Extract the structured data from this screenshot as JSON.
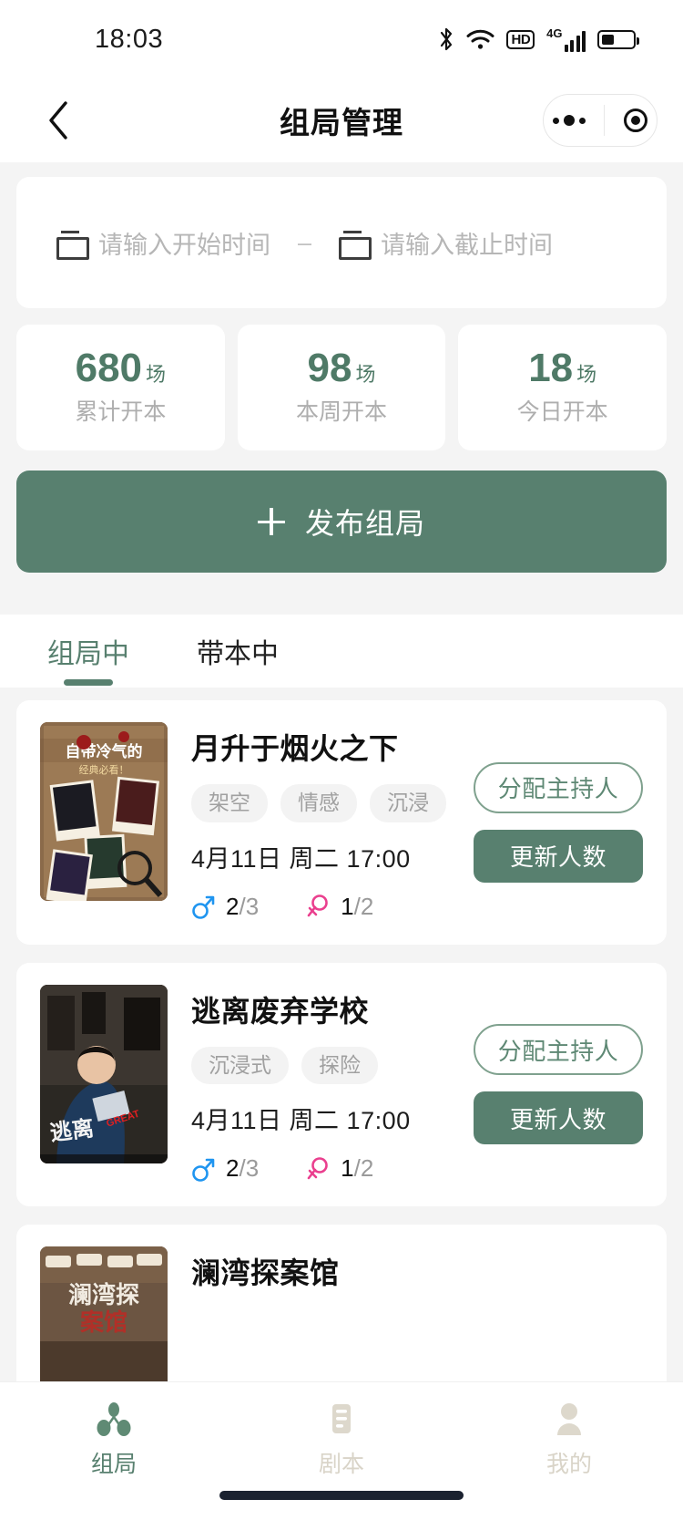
{
  "status_bar": {
    "time": "18:03",
    "icons": [
      "bluetooth-icon",
      "wifi-icon",
      "hd-icon",
      "signal-4g-icon",
      "battery-icon"
    ],
    "hd_label": "HD",
    "network_label": "4G"
  },
  "header": {
    "title": "组局管理",
    "back_icon": "chevron-left-icon",
    "capsule": {
      "menu_icon": "more-dots-icon",
      "target_icon": "target-circle-icon"
    }
  },
  "date_filter": {
    "start_placeholder": "请输入开始时间",
    "end_placeholder": "请输入截止时间",
    "separator": "–",
    "calendar_icon": "calendar-icon"
  },
  "stats": [
    {
      "value": "680",
      "unit": "场",
      "label": "累计开本"
    },
    {
      "value": "98",
      "unit": "场",
      "label": "本周开本"
    },
    {
      "value": "18",
      "unit": "场",
      "label": "今日开本"
    }
  ],
  "publish_button": {
    "label": "发布组局",
    "icon": "plus-icon"
  },
  "tabs": [
    {
      "label": "组局中",
      "active": true
    },
    {
      "label": "带本中",
      "active": false
    }
  ],
  "cards": [
    {
      "title": "月升于烟火之下",
      "tags": [
        "架空",
        "情感",
        "沉浸"
      ],
      "date": "4月11日 周二  17:00",
      "male": {
        "icon": "male-icon",
        "current": "2",
        "total": "/3"
      },
      "female": {
        "icon": "female-icon",
        "current": "1",
        "total": "/2"
      },
      "assign_label": "分配主持人",
      "update_label": "更新人数",
      "poster_alt": "自带冷气的恐怖爽文 经典必看！停内高潮！"
    },
    {
      "title": "逃离废弃学校",
      "tags": [
        "沉浸式",
        "探险"
      ],
      "date": "4月11日 周二  17:00",
      "male": {
        "icon": "male-icon",
        "current": "2",
        "total": "/3"
      },
      "female": {
        "icon": "female-icon",
        "current": "1",
        "total": "/2"
      },
      "assign_label": "分配主持人",
      "update_label": "更新人数",
      "poster_alt": "逃离废弃学校"
    },
    {
      "title": "澜湾探案馆",
      "tags": [],
      "date": "",
      "assign_label": "",
      "update_label": "",
      "poster_alt": "澜湾探案馆"
    }
  ],
  "tabbar": [
    {
      "label": "组局",
      "icon": "group-icon",
      "active": true
    },
    {
      "label": "剧本",
      "icon": "script-icon",
      "active": false
    },
    {
      "label": "我的",
      "icon": "user-icon",
      "active": false
    }
  ],
  "colors": {
    "brand_green": "#58806f",
    "stat_green": "#4f7a67",
    "male_blue": "#1f95f0",
    "female_pink": "#ea3f8e",
    "page_bg": "#f4f4f4",
    "tabbar_inactive": "#d9d4c8"
  }
}
